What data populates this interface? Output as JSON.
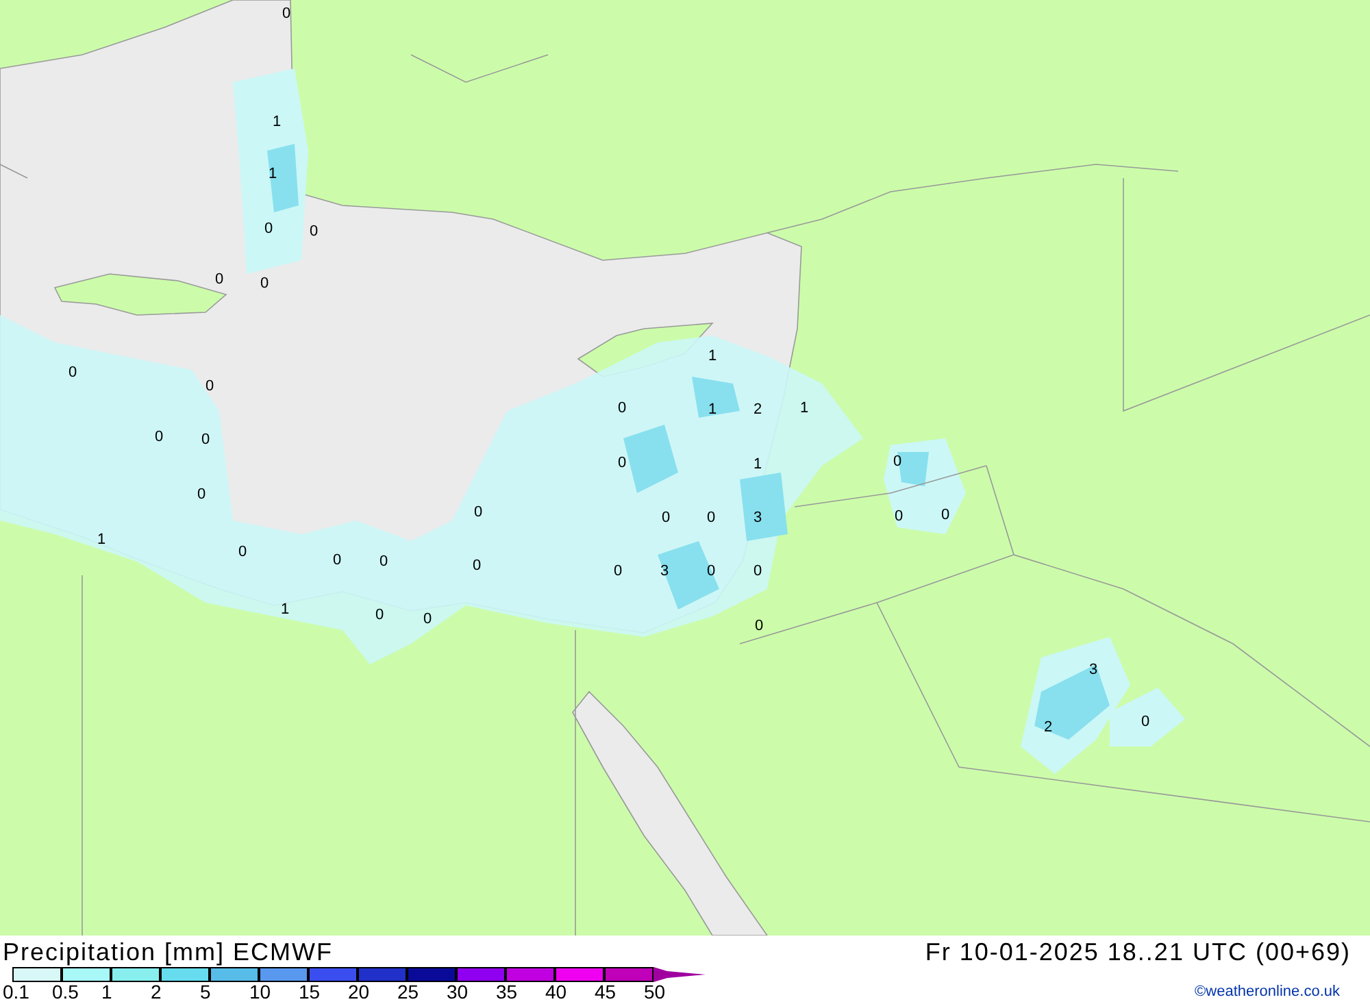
{
  "map_labels": [
    "0",
    "1",
    "1",
    "0",
    "0",
    "0",
    "0",
    "1",
    "0",
    "0",
    "0",
    "1",
    "2",
    "1",
    "0",
    "0",
    "0",
    "1",
    "0",
    "0",
    "0",
    "0",
    "0",
    "3",
    "0",
    "0",
    "1",
    "0",
    "0",
    "0",
    "0",
    "0",
    "3",
    "0",
    "0",
    "1",
    "0",
    "0",
    "0",
    "3",
    "0",
    "2"
  ],
  "title": "Precipitation [mm] ECMWF",
  "valid_time": "Fr 10-01-2025 18..21 UTC (00+69)",
  "legend": [
    {
      "kind": "box",
      "label": "0.1",
      "color": "#d8f8f8"
    },
    {
      "kind": "box",
      "label": "0.5",
      "color": "#a8f8f8"
    },
    {
      "kind": "box",
      "label": "1",
      "color": "#88eeee"
    },
    {
      "kind": "box",
      "label": "2",
      "color": "#66dcee"
    },
    {
      "kind": "box",
      "label": "5",
      "color": "#58bce8"
    },
    {
      "kind": "box",
      "label": "10",
      "color": "#5898ee"
    },
    {
      "kind": "box",
      "label": "15",
      "color": "#3a4ef0"
    },
    {
      "kind": "box",
      "label": "20",
      "color": "#2030c8"
    },
    {
      "kind": "box",
      "label": "25",
      "color": "#0a0a98"
    },
    {
      "kind": "box",
      "label": "30",
      "color": "#9000f0"
    },
    {
      "kind": "box",
      "label": "35",
      "color": "#c000e0"
    },
    {
      "kind": "box",
      "label": "40",
      "color": "#f000f0"
    },
    {
      "kind": "box",
      "label": "45",
      "color": "#c000b8"
    },
    {
      "kind": "arrow",
      "label": "50",
      "color": "#a000a0"
    }
  ],
  "credit": "©weatheronline.co.uk"
}
